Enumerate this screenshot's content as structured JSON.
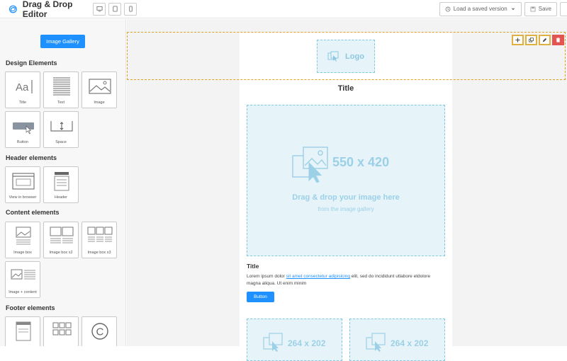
{
  "app": {
    "title": "Drag & Drop Editor"
  },
  "toolbar": {
    "devices": [
      "desktop-icon",
      "tablet-icon",
      "mobile-icon"
    ],
    "load_label": "Load a saved version",
    "save_label": "Save"
  },
  "sidebar": {
    "gallery_button": "Image Gallery",
    "sections": {
      "design": "Design Elements",
      "header": "Header elements",
      "content": "Content elements",
      "footer": "Footer elements"
    },
    "design_items": [
      "Title",
      "Text",
      "Image",
      "Button",
      "Space"
    ],
    "header_items": [
      "View in browser",
      "Header"
    ],
    "content_items": [
      "Image box",
      "Image box x2",
      "Image box x3",
      "Image + content"
    ]
  },
  "email": {
    "logo": "Logo",
    "title": "Title",
    "image_size": "550 x 420",
    "drag_text": "Drag & drop your image here",
    "from_text": "from the image gallery",
    "subtitle": "Title",
    "body_before": "Lorem ipsum dolor ",
    "body_link": "sit amet consectetur adipisicing",
    "body_after": " elit, sed do incididunt utlabore etdolore magna aliqua. Ut enim minim",
    "button": "Button",
    "small_size": "264 x 202"
  },
  "colors": {
    "accent": "#1e90ff",
    "placeholder_bg": "#e6f4fa",
    "selection": "#e0a020",
    "delete": "#e25550"
  }
}
